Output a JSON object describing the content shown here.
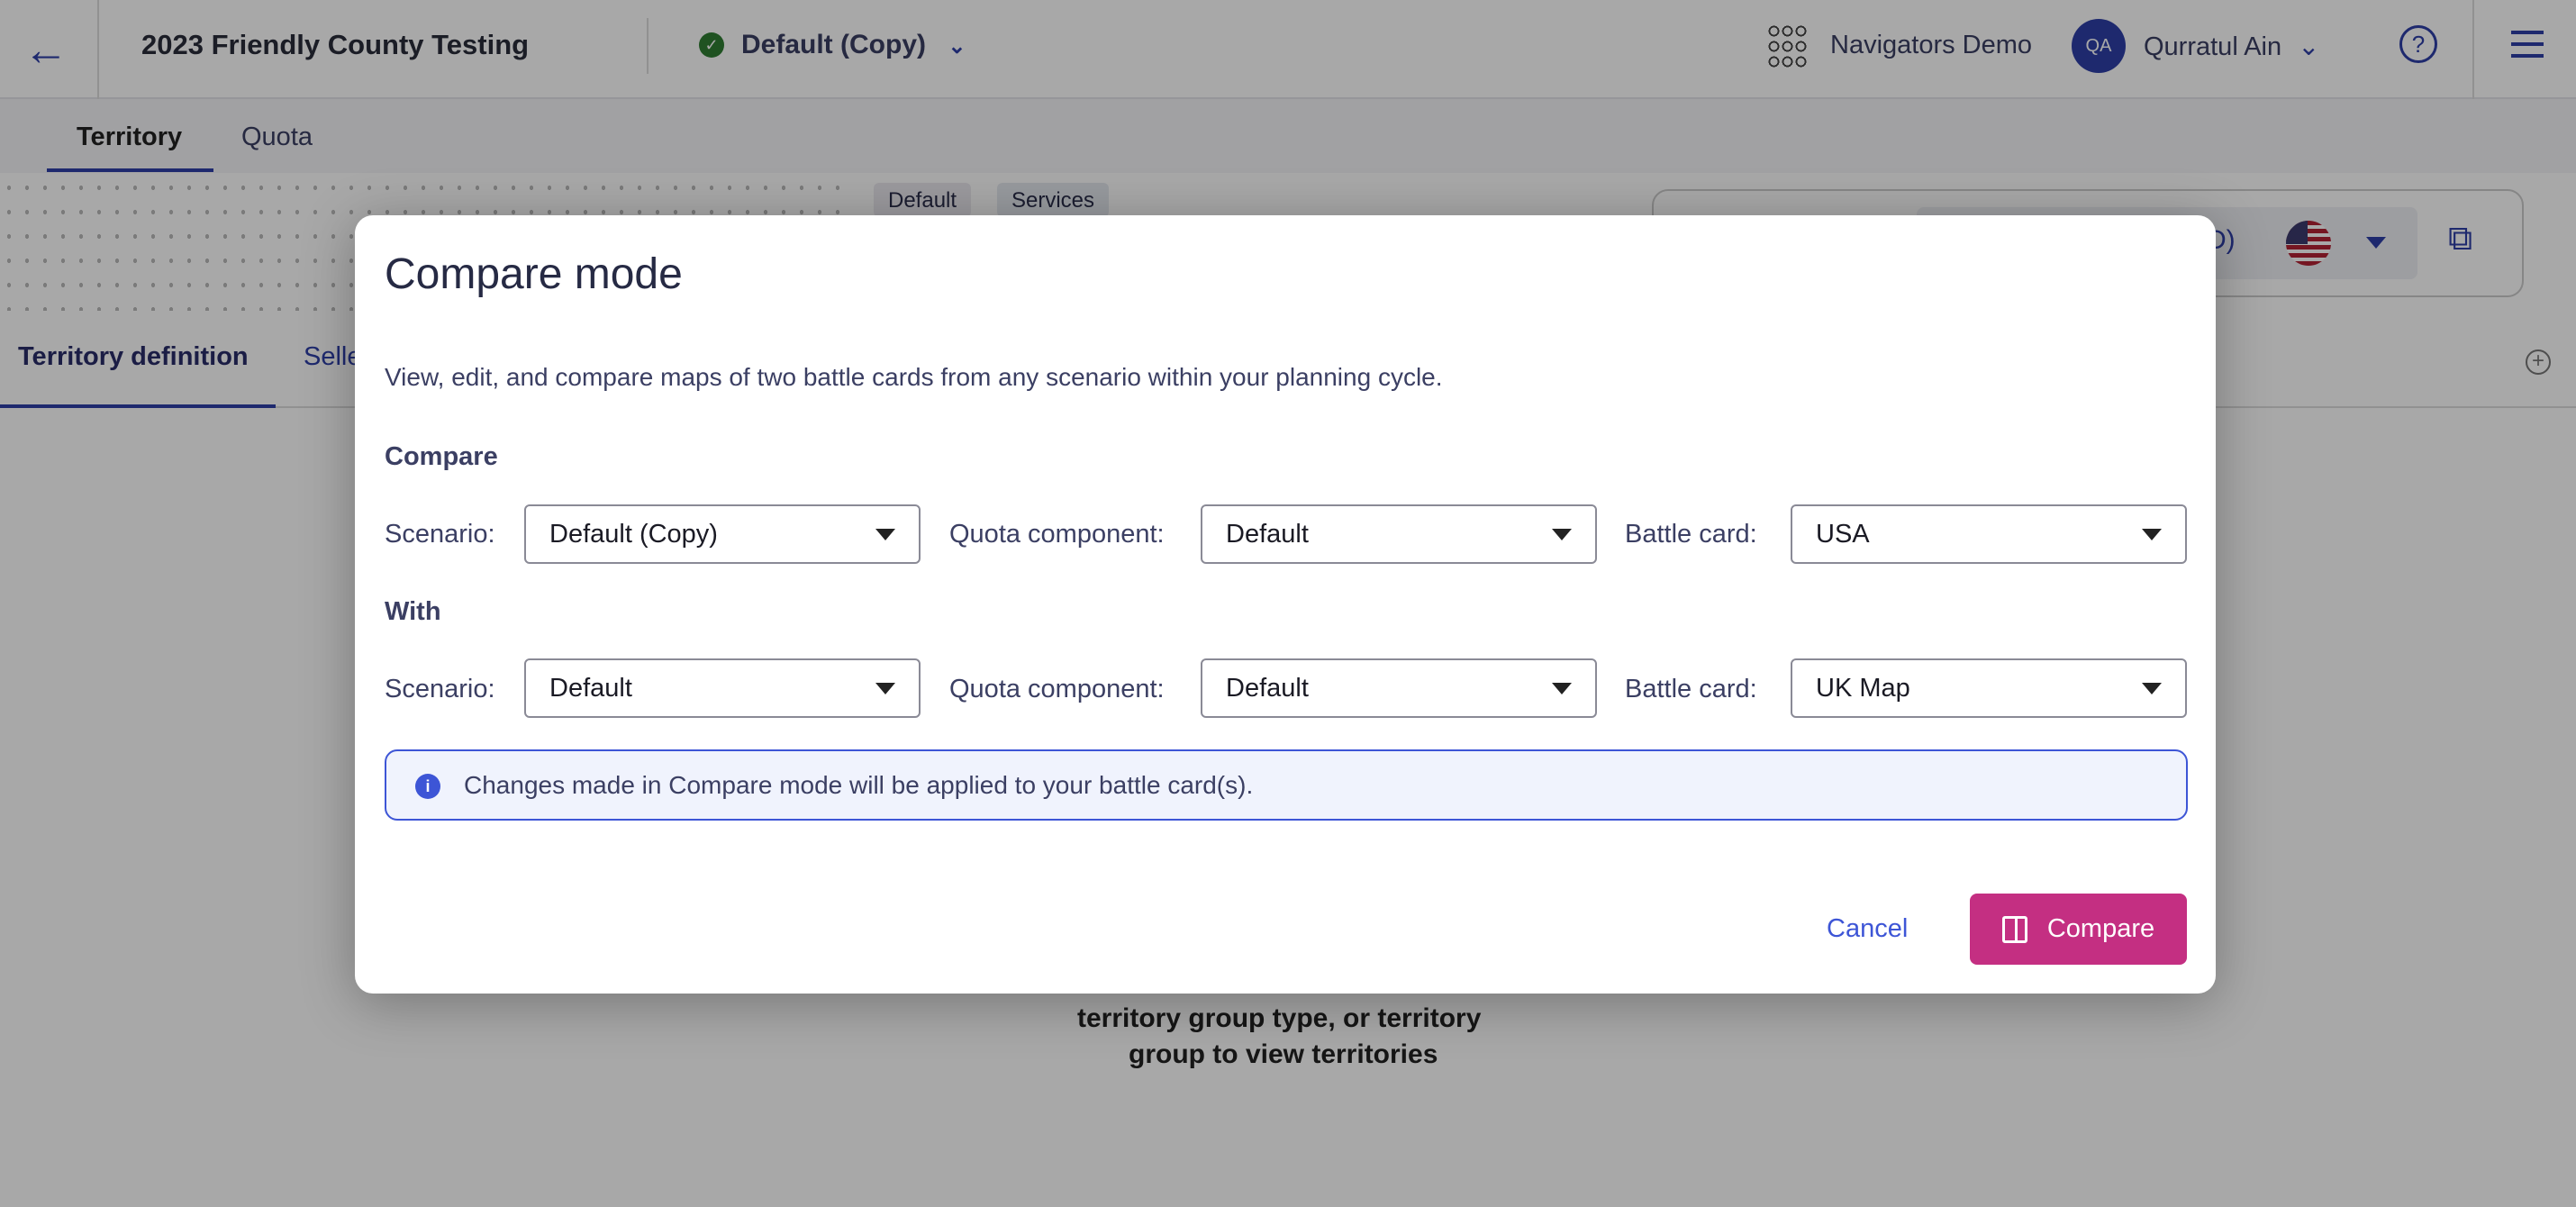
{
  "header": {
    "title": "2023 Friendly County Testing",
    "scenario": "Default (Copy)",
    "org": "Navigators Demo",
    "avatar_initials": "QA",
    "user": "Qurratul Ain"
  },
  "tabs": [
    {
      "label": "Territory"
    },
    {
      "label": "Quota"
    }
  ],
  "chips": [
    "Default",
    "Services"
  ],
  "subtabs": [
    {
      "label": "Territory definition"
    },
    {
      "label": "Selle"
    }
  ],
  "panel_partial_text": "D)",
  "empty_state": [
    "territory group type, or territory",
    "group to view territories"
  ],
  "modal": {
    "title": "Compare mode",
    "description": "View, edit, and compare maps of two battle cards from any scenario within your planning cycle.",
    "compare_label": "Compare",
    "with_label": "With",
    "scenario_label": "Scenario:",
    "quota_label": "Quota component:",
    "battlecard_label": "Battle card:",
    "rows": [
      {
        "scenario": "Default (Copy)",
        "quota": "Default",
        "battlecard": "USA"
      },
      {
        "scenario": "Default",
        "quota": "Default",
        "battlecard": "UK Map"
      }
    ],
    "info": "Changes made in Compare mode will be applied to your battle card(s).",
    "cancel": "Cancel",
    "confirm": "Compare"
  },
  "colors": {
    "accent": "#2e3fa8",
    "primary_button": "#c42f82",
    "info_bg": "#f0f3fd",
    "info_border": "#3d55d6",
    "success": "#2f7d32"
  }
}
